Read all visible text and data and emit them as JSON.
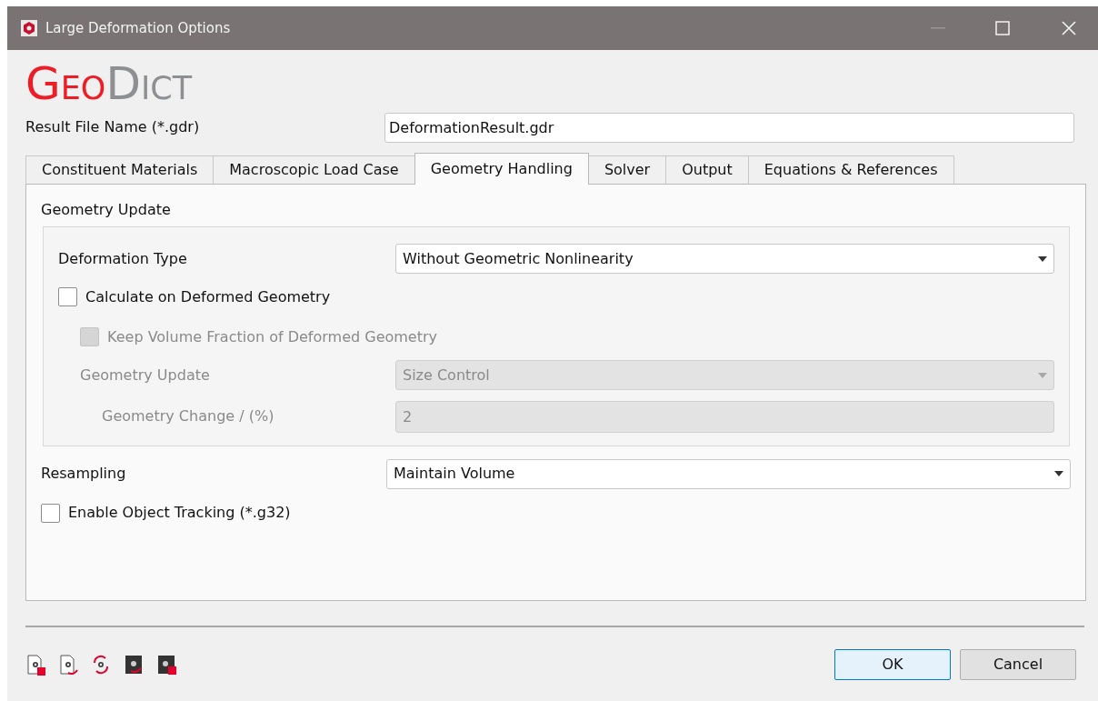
{
  "window": {
    "title": "Large Deformation Options"
  },
  "logo": {
    "first": "Geo",
    "second": "Dict"
  },
  "result_file": {
    "label": "Result File Name (*.gdr)",
    "value": "DeformationResult.gdr"
  },
  "tabs": [
    {
      "label": "Constituent Materials",
      "selected": false
    },
    {
      "label": "Macroscopic Load Case",
      "selected": false
    },
    {
      "label": "Geometry Handling",
      "selected": true
    },
    {
      "label": "Solver",
      "selected": false
    },
    {
      "label": "Output",
      "selected": false
    },
    {
      "label": "Equations & References",
      "selected": false
    }
  ],
  "geometry_update": {
    "title": "Geometry Update",
    "items": [
      {
        "kind": "combo",
        "label": "Deformation Type",
        "value": "Without Geometric Nonlinearity",
        "disabled": false
      },
      {
        "kind": "checkbox",
        "label": "Calculate on Deformed Geometry",
        "checked": false,
        "disabled": false,
        "children": [
          {
            "kind": "checkbox",
            "label": "Keep Volume Fraction of Deformed Geometry",
            "checked": false,
            "disabled": true
          },
          {
            "kind": "combo",
            "label": "Geometry Update",
            "value": "Size Control",
            "disabled": true,
            "children": [
              {
                "kind": "field",
                "label": "Geometry Change / (%)",
                "value": "2",
                "disabled": true
              }
            ]
          }
        ]
      }
    ]
  },
  "options": [
    {
      "kind": "combo",
      "label": "Resampling",
      "value": "Maintain Volume",
      "disabled": false
    },
    {
      "kind": "checkbox",
      "label": "Enable Object Tracking (*.g32)",
      "checked": false,
      "disabled": false
    }
  ],
  "buttons": [
    "OK",
    "Cancel"
  ]
}
